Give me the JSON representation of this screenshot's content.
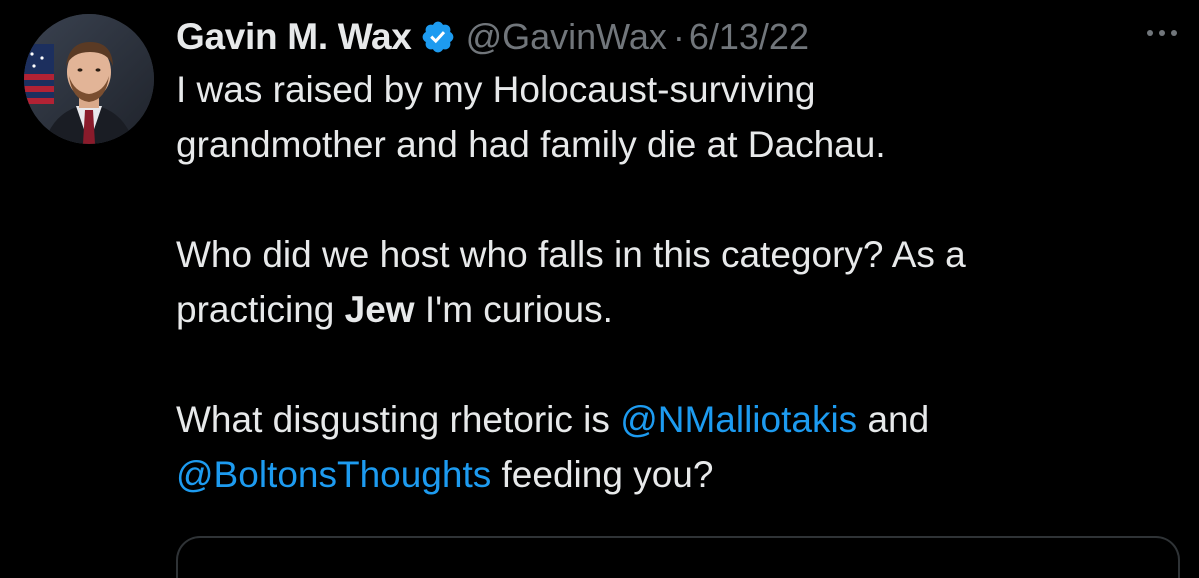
{
  "user": {
    "display_name": "Gavin M. Wax",
    "handle": "@GavinWax",
    "separator": "·",
    "date": "6/13/22",
    "verified_color": "#1d9bf0"
  },
  "tweet": {
    "line1": "I was raised by my Holocaust-surviving",
    "line2": "grandmother and had family die at Dachau.",
    "line3": "Who did we host who falls in this category? As a",
    "line4_pre": "practicing ",
    "line4_bold": "Jew",
    "line4_post": " I'm curious.",
    "line5_pre": "What disgusting rhetoric is ",
    "line5_mention": "@NMalliotakis",
    "line5_post": " and",
    "line6_mention": "@BoltonsThoughts",
    "line6_post": " feeding you?"
  },
  "colors": {
    "background": "#000000",
    "text": "#e7e9ea",
    "secondary": "#71767b",
    "link": "#1d9bf0"
  },
  "icons": {
    "verified": "verified-badge-icon",
    "more": "more-options-icon"
  }
}
